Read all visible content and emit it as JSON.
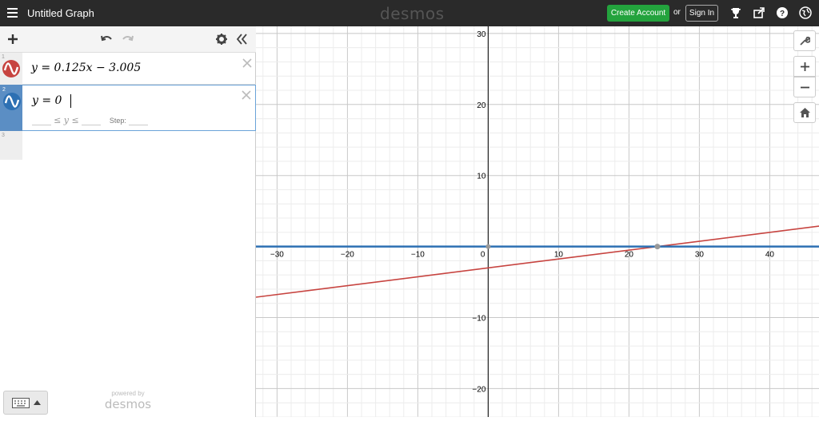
{
  "topbar": {
    "title": "Untitled Graph",
    "logo": "desmos",
    "create_account": "Create Account",
    "or": "or",
    "sign_in": "Sign In"
  },
  "expressions": [
    {
      "index": "1",
      "latex": "y = 0.125x − 3.005",
      "color": "#c74440",
      "icon": "sine-wave-icon"
    },
    {
      "index": "2",
      "latex": "y = 0",
      "color": "#2d70b3",
      "icon": "sine-wave-icon",
      "domain": {
        "relation": "≤ y ≤",
        "step_label": "Step:"
      }
    },
    {
      "index": "3",
      "latex": ""
    }
  ],
  "footer": {
    "powered_by": "powered by",
    "brand": "desmos"
  },
  "chart_data": {
    "type": "line",
    "xlim": [
      -33,
      47
    ],
    "ylim": [
      -24,
      31
    ],
    "grid": true,
    "x_ticks": [
      -30,
      -20,
      -10,
      0,
      10,
      20,
      30,
      40
    ],
    "y_ticks": [
      -20,
      -10,
      10,
      20,
      30
    ],
    "series": [
      {
        "equation": "y = 0.125x - 3.005",
        "slope": 0.125,
        "intercept": -3.005,
        "color": "#c74440"
      },
      {
        "equation": "y = 0",
        "slope": 0,
        "intercept": 0,
        "color": "#2d70b3"
      }
    ],
    "intersection": {
      "x": 24.04,
      "y": 0
    }
  }
}
